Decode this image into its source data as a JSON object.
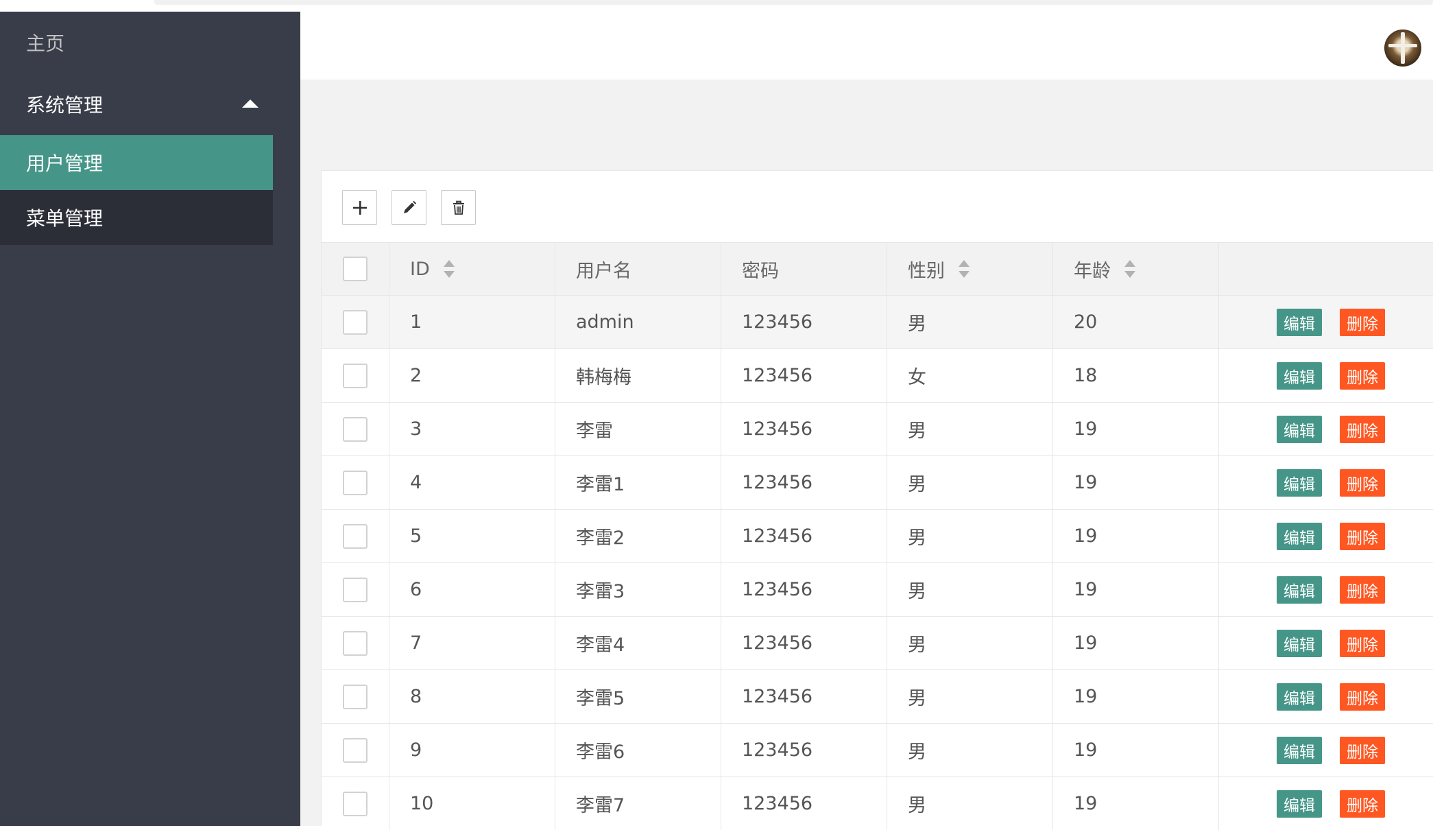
{
  "sidebar": {
    "home": "主页",
    "group": "系统管理",
    "items": [
      {
        "label": "用户管理",
        "active": true
      },
      {
        "label": "菜单管理",
        "active": false
      }
    ]
  },
  "toolbar": {
    "add_icon": "plus-icon",
    "edit_icon": "pencil-icon",
    "delete_icon": "trash-icon"
  },
  "table": {
    "headers": [
      "ID",
      "用户名",
      "密码",
      "性别",
      "年龄"
    ],
    "actions": {
      "edit": "编辑",
      "delete": "删除"
    },
    "rows": [
      {
        "id": "1",
        "username": "admin",
        "password": "123456",
        "gender": "男",
        "age": "20"
      },
      {
        "id": "2",
        "username": "韩梅梅",
        "password": "123456",
        "gender": "女",
        "age": "18"
      },
      {
        "id": "3",
        "username": "李雷",
        "password": "123456",
        "gender": "男",
        "age": "19"
      },
      {
        "id": "4",
        "username": "李雷1",
        "password": "123456",
        "gender": "男",
        "age": "19"
      },
      {
        "id": "5",
        "username": "李雷2",
        "password": "123456",
        "gender": "男",
        "age": "19"
      },
      {
        "id": "6",
        "username": "李雷3",
        "password": "123456",
        "gender": "男",
        "age": "19"
      },
      {
        "id": "7",
        "username": "李雷4",
        "password": "123456",
        "gender": "男",
        "age": "19"
      },
      {
        "id": "8",
        "username": "李雷5",
        "password": "123456",
        "gender": "男",
        "age": "19"
      },
      {
        "id": "9",
        "username": "李雷6",
        "password": "123456",
        "gender": "男",
        "age": "19"
      },
      {
        "id": "10",
        "username": "李雷7",
        "password": "123456",
        "gender": "男",
        "age": "19"
      }
    ]
  },
  "colors": {
    "sidebar_bg": "#393d49",
    "active_bg": "#459688",
    "edit_btn": "#459688",
    "delete_btn": "#ff5722"
  }
}
